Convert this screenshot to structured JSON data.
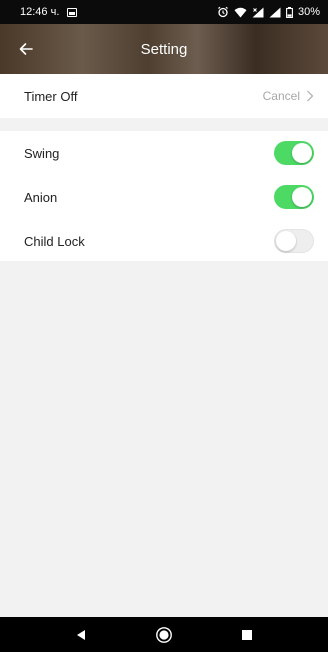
{
  "status_bar": {
    "time": "12:46 ч.",
    "battery": "30%"
  },
  "header": {
    "title": "Setting"
  },
  "timer_row": {
    "label": "Timer Off",
    "value": "Cancel"
  },
  "switches": [
    {
      "label": "Swing",
      "on": true
    },
    {
      "label": "Anion",
      "on": true
    },
    {
      "label": "Child Lock",
      "on": false
    }
  ],
  "colors": {
    "toggle_on": "#4cd964",
    "toggle_off": "#eeeeee",
    "header_bg": "#4e3f30"
  },
  "icons": {
    "back": "arrow-left-icon",
    "chevron": "chevron-right-icon",
    "nav_back": "triangle-back-icon",
    "nav_home": "circle-home-icon",
    "nav_recent": "square-recent-icon"
  }
}
